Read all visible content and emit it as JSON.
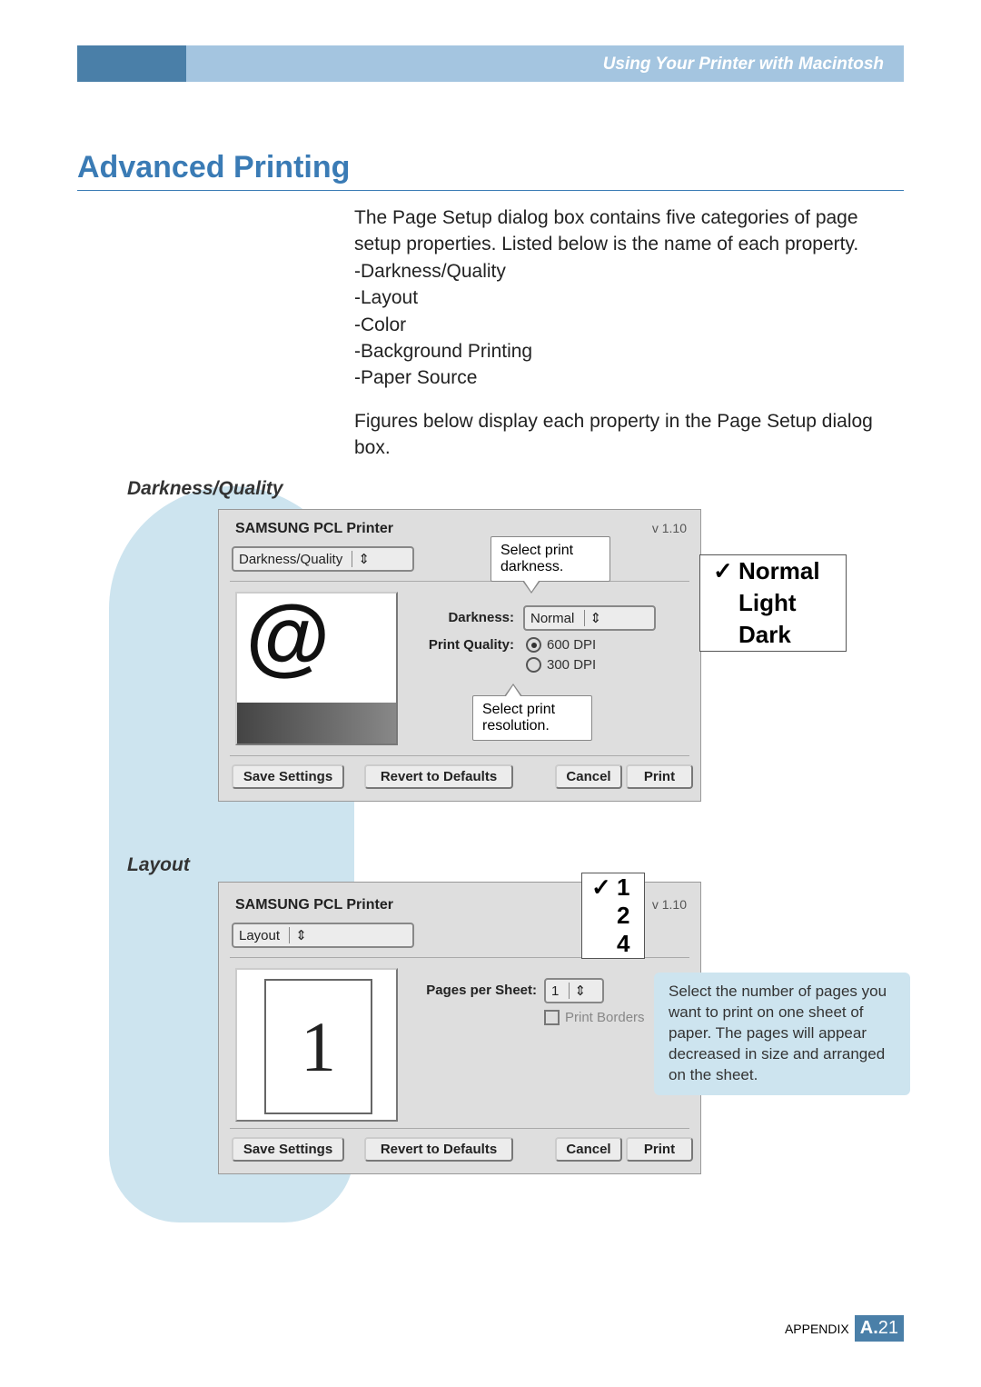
{
  "header": {
    "chapter": "Using Your Printer with Macintosh"
  },
  "title": "Advanced Printing",
  "intro_p1": "The Page Setup dialog box contains five categories of page setup properties. Listed below is the name of each property.",
  "intro_list": [
    "-Darkness/Quality",
    "-Layout",
    "-Color",
    "-Background Printing",
    "-Paper Source"
  ],
  "intro_p2": "Figures below display each property in the Page Setup dialog box.",
  "section1": {
    "heading": "Darkness/Quality",
    "printer": "SAMSUNG PCL Printer",
    "version": "v 1.10",
    "tab": "Darkness/Quality",
    "darkness_label": "Darkness:",
    "darkness_value": "Normal",
    "quality_label": "Print Quality:",
    "radio1": "600 DPI",
    "radio2": "300 DPI",
    "callout_darkness": "Select print darkness.",
    "callout_quality": "Select print resolution.",
    "zoom_options": [
      "Normal",
      "Light",
      "Dark"
    ],
    "btn_save": "Save Settings",
    "btn_revert": "Revert to Defaults",
    "btn_cancel": "Cancel",
    "btn_print": "Print"
  },
  "section2": {
    "heading": "Layout",
    "printer": "SAMSUNG PCL Printer",
    "version": "v 1.10",
    "tab": "Layout",
    "pps_label": "Pages per Sheet:",
    "pps_value": "1",
    "borders_label": "Print Borders",
    "zoom_options": [
      "1",
      "2",
      "4"
    ],
    "tip": "Select the number of pages you want to print on one sheet of paper. The pages will appear decreased in size and arranged on the sheet.",
    "btn_save": "Save Settings",
    "btn_revert": "Revert to Defaults",
    "btn_cancel": "Cancel",
    "btn_print": "Print"
  },
  "footer": {
    "label": "APPENDIX",
    "pre": "A.",
    "num": "21"
  }
}
